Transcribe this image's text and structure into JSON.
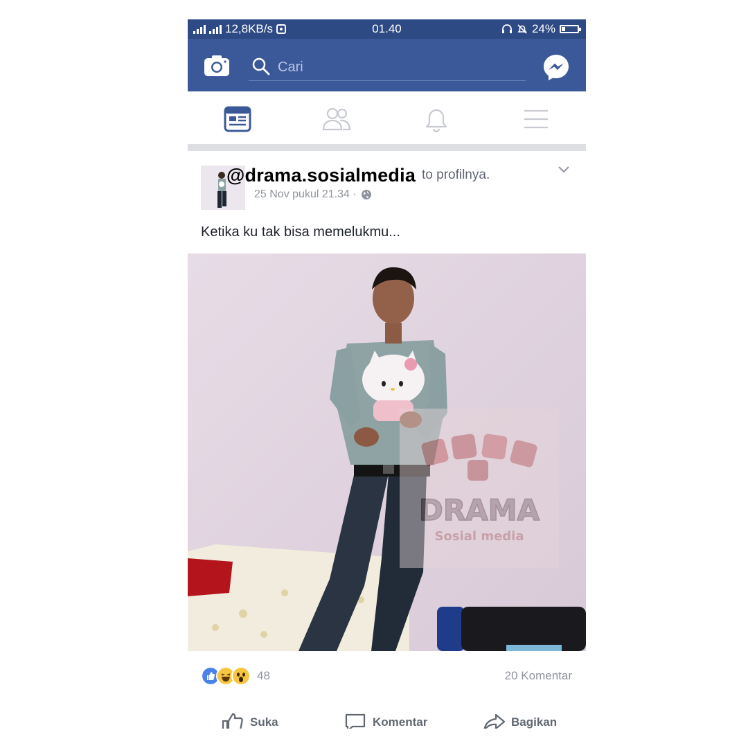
{
  "status_bar": {
    "network_speed": "12,8KB/s",
    "time": "01.40",
    "battery_percent": "24%",
    "battery_level": 0.24
  },
  "header": {
    "search_placeholder": "Cari"
  },
  "tabs": [
    {
      "name": "news-feed",
      "active": true
    },
    {
      "name": "friends",
      "active": false
    },
    {
      "name": "notifications",
      "active": false
    },
    {
      "name": "menu",
      "active": false
    }
  ],
  "post": {
    "watermark_handle": "@drama.sosialmedia",
    "header_suffix": "to profilnya.",
    "timestamp": "25 Nov pukul 21.34 ·",
    "text": "Ketika ku tak bisa memelukmu...",
    "watermark_logo": "DRAMA Sosial media",
    "reactions": [
      "like",
      "haha",
      "wow"
    ],
    "reaction_count": "48",
    "comment_count": "20 Komentar"
  },
  "actions": {
    "like_label": "Suka",
    "comment_label": "Komentar",
    "share_label": "Bagikan"
  },
  "colors": {
    "header_bg": "#3b5998",
    "status_bg": "#2e4a85",
    "active_tab": "#3b5998",
    "inactive_tab": "#c7cad1"
  }
}
